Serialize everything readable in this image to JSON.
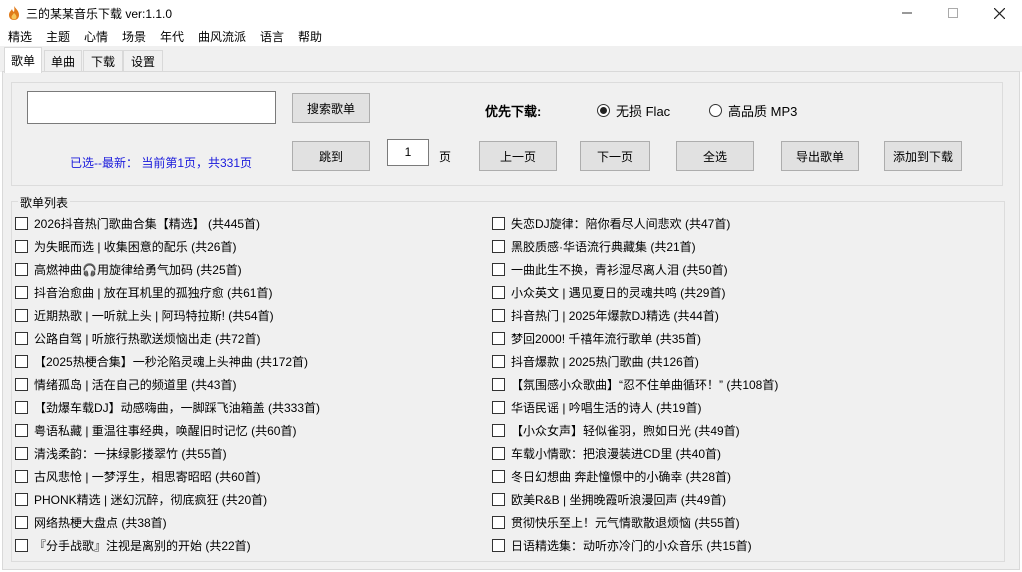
{
  "window": {
    "title": "三的某某音乐下载 ver:1.1.0",
    "minimize_glyph": "—",
    "maximize_glyph": "☐",
    "close_glyph": "✕"
  },
  "menu": [
    "精选",
    "主题",
    "心情",
    "场景",
    "年代",
    "曲风流派",
    "语言",
    "帮助"
  ],
  "tabs": [
    {
      "label": "歌单",
      "active": true
    },
    {
      "label": "单曲",
      "active": false
    },
    {
      "label": "下载",
      "active": false
    },
    {
      "label": "设置",
      "active": false
    }
  ],
  "search": {
    "input_value": "",
    "search_button": "搜索歌单",
    "priority_label": "优先下载:",
    "radio_lossless": "无损 Flac",
    "radio_mp3": "高品质 MP3",
    "selected": "lossless",
    "status_text": "已选--最新：  当前第1页，共331页",
    "jump_button": "跳到",
    "page_value": "1",
    "page_unit": "页",
    "prev_button": "上一页",
    "next_button": "下一页",
    "select_all_button": "全选",
    "export_button": "导出歌单",
    "add_download_button": "添加到下载"
  },
  "playlist_group": {
    "title": "歌单列表",
    "left": [
      "2026抖音热门歌曲合集【精选】 (共445首)",
      "为失眠而选 | 收集困意的配乐 (共26首)",
      "高燃神曲🎧用旋律给勇气加码 (共25首)",
      "抖音治愈曲 | 放在耳机里的孤独疗愈 (共61首)",
      "近期热歌 | 一听就上头 | 阿玛特拉斯! (共54首)",
      "公路自驾 | 听旅行热歌送烦恼出走 (共72首)",
      "【2025热梗合集】一秒沦陷灵魂上头神曲 (共172首)",
      "情绪孤岛 | 活在自己的频道里 (共43首)",
      "【劲爆车载DJ】动感嗨曲，一脚踩飞油箱盖 (共333首)",
      "粤语私藏 | 重温往事经典，唤醒旧时记忆 (共60首)",
      "清浅柔韵：一抹绿影搂翠竹 (共55首)",
      "古风悲怆 | 一梦浮生，相思寄昭昭 (共60首)",
      "PHONK精选 | 迷幻沉醉，彻底疯狂 (共20首)",
      "网络热梗大盘点 (共38首)",
      "『分手战歌』注视是离别的开始 (共22首)"
    ],
    "right": [
      "失恋DJ旋律：陪你看尽人间悲欢 (共47首)",
      "黑胶质感·华语流行典藏集 (共21首)",
      "一曲此生不换，青衫湿尽离人泪 (共50首)",
      "小众英文 | 遇见夏日的灵魂共鸣 (共29首)",
      "抖音热门 | 2025年爆款DJ精选 (共44首)",
      "梦回2000! 千禧年流行歌单 (共35首)",
      "抖音爆款 | 2025热门歌曲 (共126首)",
      "【氛围感小众歌曲】“忍不住单曲循环！” (共108首)",
      "华语民谣 | 吟唱生活的诗人 (共19首)",
      "【小众女声】轻似雀羽，煦如日光 (共49首)",
      "车载小情歌：把浪漫装进CD里 (共40首)",
      "冬日幻想曲 奔赴憧憬中的小确幸 (共28首)",
      "欧美R&B | 坐拥晚霞听浪漫回声 (共49首)",
      "贯彻快乐至上！元气情歌散退烦恼 (共55首)",
      "日语精选集：动听亦冷门的小众音乐 (共15首)"
    ]
  }
}
